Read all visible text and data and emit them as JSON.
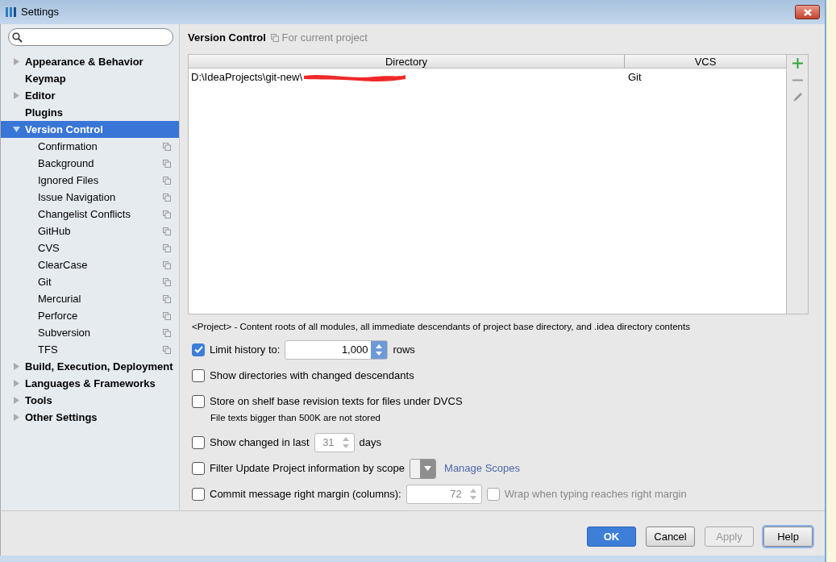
{
  "window": {
    "title": "Settings"
  },
  "sidebar": {
    "items": [
      {
        "label": "Appearance & Behavior",
        "selected": false,
        "expanded": false
      },
      {
        "label": "Keymap",
        "selected": false
      },
      {
        "label": "Editor",
        "selected": false,
        "expanded": false
      },
      {
        "label": "Plugins",
        "selected": false
      },
      {
        "label": "Version Control",
        "selected": true,
        "expanded": true,
        "children": [
          {
            "label": "Confirmation",
            "selected": false,
            "per_project": true
          },
          {
            "label": "Background",
            "selected": false,
            "per_project": true
          },
          {
            "label": "Ignored Files",
            "selected": false,
            "per_project": true
          },
          {
            "label": "Issue Navigation",
            "selected": false,
            "per_project": true
          },
          {
            "label": "Changelist Conflicts",
            "selected": false,
            "per_project": true
          },
          {
            "label": "GitHub",
            "selected": false,
            "per_project": true
          },
          {
            "label": "CVS",
            "selected": false,
            "per_project": true
          },
          {
            "label": "ClearCase",
            "selected": false,
            "per_project": true
          },
          {
            "label": "Git",
            "selected": false,
            "per_project": true
          },
          {
            "label": "Mercurial",
            "selected": false,
            "per_project": true
          },
          {
            "label": "Perforce",
            "selected": false,
            "per_project": true
          },
          {
            "label": "Subversion",
            "selected": false,
            "per_project": true
          },
          {
            "label": "TFS",
            "selected": false,
            "per_project": true
          }
        ]
      },
      {
        "label": "Build, Execution, Deployment",
        "selected": false,
        "expanded": false
      },
      {
        "label": "Languages & Frameworks",
        "selected": false,
        "expanded": false
      },
      {
        "label": "Tools",
        "selected": false,
        "expanded": false
      },
      {
        "label": "Other Settings",
        "selected": false,
        "expanded": false
      }
    ]
  },
  "page": {
    "title": "Version Control",
    "scope": "For current project"
  },
  "table": {
    "columns": [
      "Directory",
      "VCS"
    ],
    "rows": [
      {
        "cells": [
          "D:\\IdeaProjects\\git-new\\",
          "Git"
        ],
        "redacted": true
      }
    ]
  },
  "note": "<Project> - Content roots of all modules, all immediate descendants of project base directory, and .idea directory contents",
  "options": [
    {
      "kind": "spinner",
      "label": "Limit history to:",
      "checked": true,
      "value": "1,000",
      "suffix": "rows",
      "disabled": false
    },
    {
      "kind": "check",
      "label": "Show directories with changed descendants",
      "checked": false
    },
    {
      "kind": "check",
      "label": "Store on shelf base revision texts for files under DVCS",
      "checked": false,
      "hint": "File texts bigger than 500K are not stored"
    },
    {
      "kind": "spinner",
      "label": "Show changed in last",
      "checked": false,
      "value": "31",
      "suffix": "days",
      "disabled": true
    },
    {
      "kind": "scope",
      "label": "Filter Update Project information by scope",
      "checked": false,
      "link": "Manage Scopes"
    },
    {
      "kind": "spinner",
      "label": "Commit message right margin (columns):",
      "checked": false,
      "value": "72",
      "disabled": true,
      "extra": {
        "label": "Wrap when typing reaches right margin",
        "checked": false,
        "disabled": true
      }
    }
  ],
  "buttons": [
    {
      "label": "OK",
      "primary": true,
      "disabled": false,
      "focused": false
    },
    {
      "label": "Cancel",
      "primary": false,
      "disabled": false,
      "focused": false
    },
    {
      "label": "Apply",
      "primary": false,
      "disabled": true,
      "focused": false
    },
    {
      "label": "Help",
      "primary": false,
      "disabled": false,
      "focused": true
    }
  ]
}
